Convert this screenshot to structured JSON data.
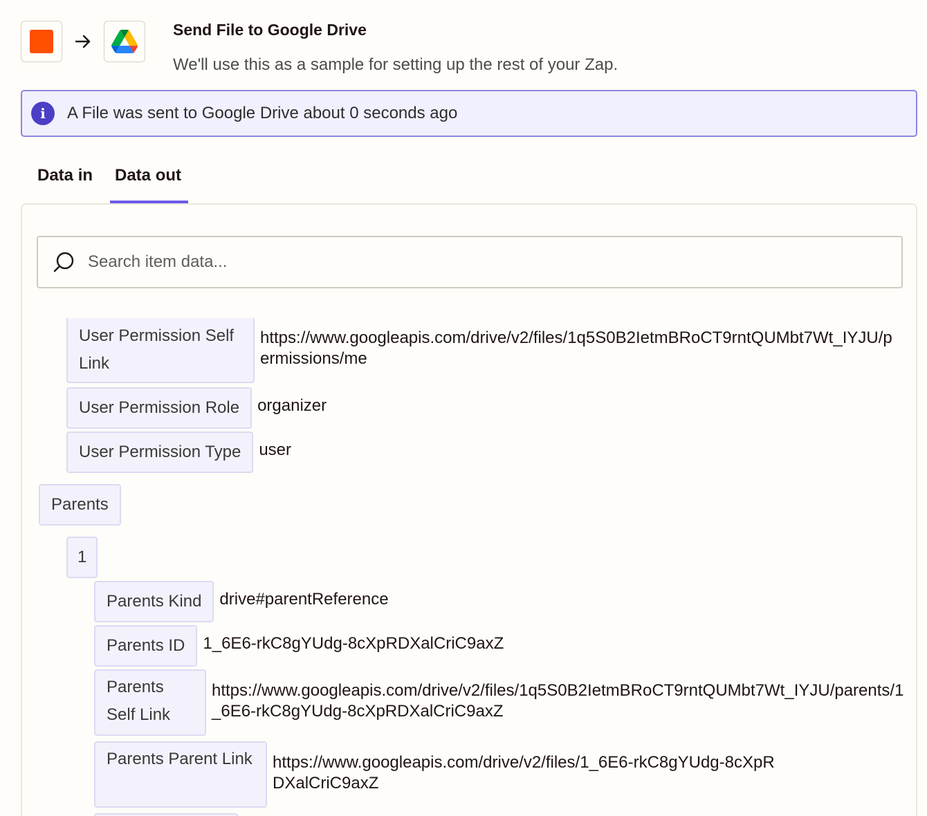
{
  "header": {
    "title": "Send File to Google Drive",
    "subtitle": "We'll use this as a sample for setting up the rest of your Zap.",
    "trigger_icon": "zapier-orange-square-icon",
    "action_icon": "google-drive-icon",
    "brand_color": "#ff4f00"
  },
  "banner": {
    "text": "A File was sent to Google Drive about 0 seconds ago",
    "icon": "info-icon",
    "accent": "#4b3fc6"
  },
  "tabs": [
    {
      "label": "Data in",
      "active": false
    },
    {
      "label": "Data out",
      "active": true
    }
  ],
  "search": {
    "placeholder": "Search item data..."
  },
  "fields": [
    {
      "key": "User Permission Self Link",
      "value": "https://www.googleapis.com/drive/v2/files/1q5S0B2IetmBRoCT9rntQUMbt7Wt_IYJU/permissions/me"
    },
    {
      "key": "User Permission Role",
      "value": "organizer"
    },
    {
      "key": "User Permission Type",
      "value": "user"
    },
    {
      "key": "Parents",
      "value": ""
    },
    {
      "key": "1",
      "value": ""
    },
    {
      "key": "Parents Kind",
      "value": "drive#parentReference"
    },
    {
      "key": "Parents ID",
      "value": "1_6E6-rkC8gYUdg-8cXpRDXalCriC9axZ"
    },
    {
      "key": "Parents Self Link",
      "value": "https://www.googleapis.com/drive/v2/files/1q5S0B2IetmBRoCT9rntQUMbt7Wt_IYJU/parents/1_6E6-rkC8gYUdg-8cXpRDXalCriC9axZ"
    },
    {
      "key": "Parents Parent Link",
      "value": "https://www.googleapis.com/drive/v2/files/1_6E6-rkC8gYUdg-8cXpRDXalCriC9axZ"
    }
  ]
}
